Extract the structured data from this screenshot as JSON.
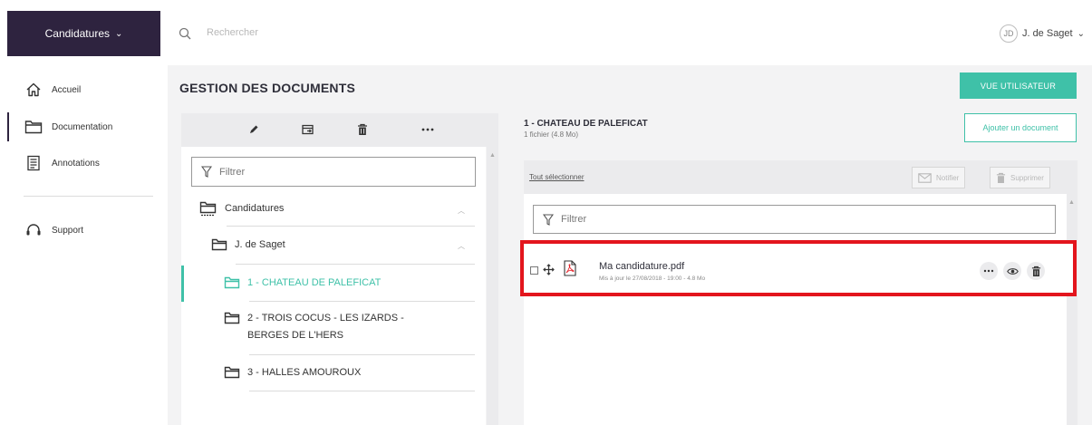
{
  "sidebar": {
    "brand_label": "Candidatures",
    "items": [
      {
        "label": "Accueil"
      },
      {
        "label": "Documentation"
      },
      {
        "label": "Annotations"
      },
      {
        "label": "Support"
      }
    ]
  },
  "topbar": {
    "search_placeholder": "Rechercher",
    "user_initials": "JD",
    "user_name": "J. de Saget"
  },
  "main": {
    "page_title": "GESTION DES DOCUMENTS",
    "user_view_button": "VUE UTILISATEUR",
    "tree": {
      "filter_placeholder": "Filtrer",
      "nodes": [
        {
          "label": "Candidatures"
        },
        {
          "label": "J. de Saget"
        },
        {
          "label": "1 - CHATEAU DE PALEFICAT"
        },
        {
          "label_line1": "2 - TROIS COCUS - LES IZARDS -",
          "label_line2": "BERGES DE L'HERS"
        },
        {
          "label": "3 - HALLES AMOUROUX"
        }
      ]
    },
    "folder": {
      "title": "1 - CHATEAU DE PALEFICAT",
      "subtitle": "1 fichier (4.8 Mo)",
      "add_button": "Ajouter un document",
      "select_all": "Tout sélectionner",
      "notify_button": "Notifier",
      "delete_button": "Supprimer",
      "filter_placeholder": "Filtrer",
      "documents": [
        {
          "name": "Ma candidature.pdf",
          "meta": "Mis à jour le 27/08/2018 - 19:00 - 4.8 Mo"
        }
      ]
    }
  },
  "colors": {
    "brand": "#2e233f",
    "accent": "#3fc1a8",
    "highlight": "#e3151d"
  }
}
